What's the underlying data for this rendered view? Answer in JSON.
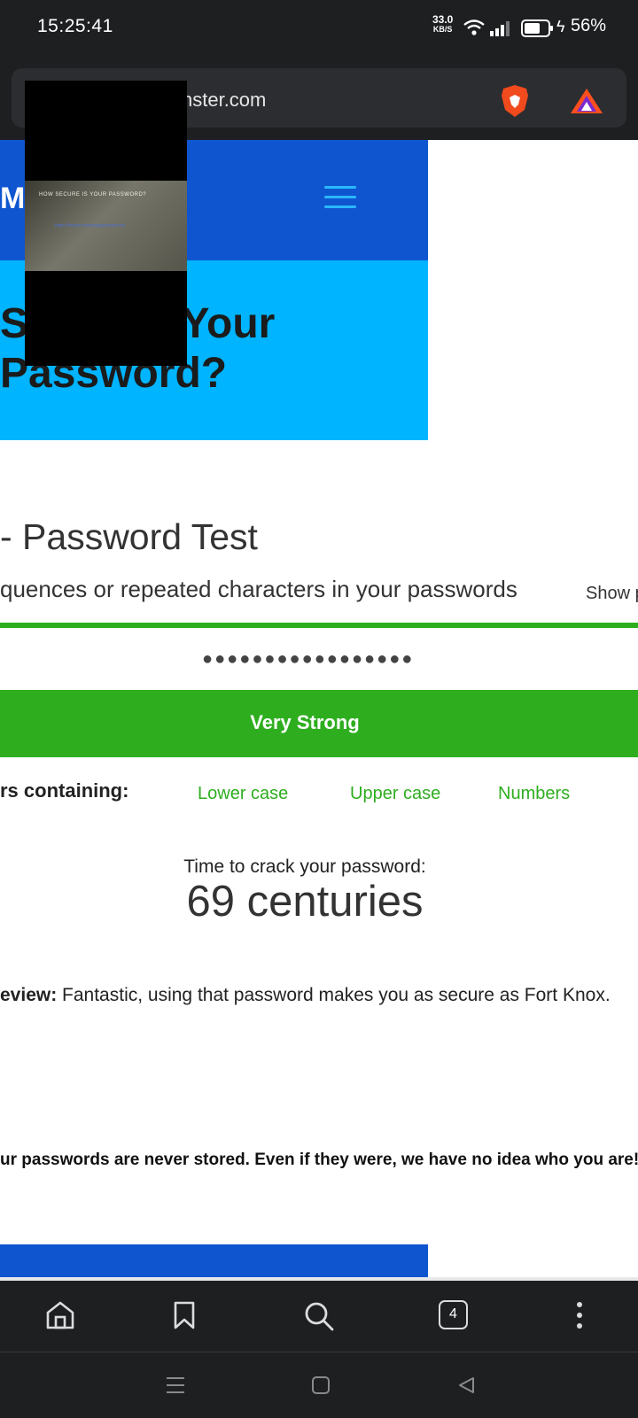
{
  "status_bar": {
    "time": "15:25:41",
    "net_speed": "33.0",
    "net_unit": "KB/S",
    "battery_percent": "56%"
  },
  "browser": {
    "url": "nster.com"
  },
  "site": {
    "logo_letter": "M",
    "hero_title_line1": "S          s Your",
    "hero_title_line2": "Password?",
    "overlay_text1": "HOW SECURE IS YOUR PASSWORD?",
    "overlay_text2": "https://howsecureismypassword.net",
    "test_title": "- Password Test",
    "test_subtitle": "quences or repeated characters in your passwords",
    "show_password_label": "Show p",
    "password_masked": "●●●●●●●●●●●●●●●●●",
    "strength": "Very Strong",
    "contains_label": "rs containing:",
    "contains_tags": [
      "Lower case",
      "Upper case",
      "Numbers"
    ],
    "crack_label": "Time to crack your password:",
    "crack_value": "69 centuries",
    "review_label": "eview:",
    "review_text": " Fantastic, using that password makes you as secure as Fort Knox.",
    "privacy_note": "ur passwords are never stored. Even if they were, we have no idea who you are!"
  },
  "bottom_nav": {
    "tabs_count": "4"
  },
  "colors": {
    "strength_green": "#2eae1f",
    "header_blue": "#0f55d0",
    "hero_cyan": "#00b4ff"
  }
}
